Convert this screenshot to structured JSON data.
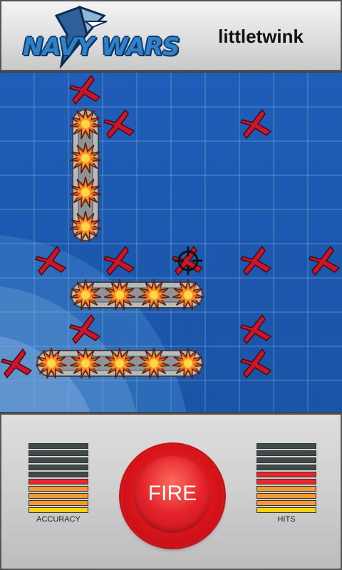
{
  "header": {
    "logo_text": "NAVY WARS",
    "player_name": "littletwink"
  },
  "board": {
    "rows": 10,
    "cols": 10,
    "misses": [
      [
        2,
        0
      ],
      [
        3,
        1
      ],
      [
        7,
        1
      ],
      [
        1,
        5
      ],
      [
        3,
        5
      ],
      [
        5,
        5
      ],
      [
        7,
        5
      ],
      [
        9,
        5
      ],
      [
        2,
        7
      ],
      [
        7,
        7
      ],
      [
        0,
        8
      ],
      [
        7,
        8
      ]
    ],
    "hits": [
      [
        2,
        1
      ],
      [
        2,
        2
      ],
      [
        2,
        3
      ],
      [
        2,
        4
      ],
      [
        2,
        6
      ],
      [
        3,
        6
      ],
      [
        4,
        6
      ],
      [
        5,
        6
      ],
      [
        1,
        8
      ],
      [
        2,
        8
      ],
      [
        3,
        8
      ],
      [
        4,
        8
      ],
      [
        5,
        8
      ]
    ],
    "ships": [
      {
        "col": 2,
        "row": 1,
        "length": 4,
        "orientation": "vertical"
      },
      {
        "col": 2,
        "row": 6,
        "length": 4,
        "orientation": "horizontal"
      },
      {
        "col": 1,
        "row": 8,
        "length": 5,
        "orientation": "horizontal"
      }
    ],
    "crosshair": [
      5,
      5
    ]
  },
  "controls": {
    "fire_label": "FIRE",
    "accuracy": {
      "label": "ACCURACY",
      "bars": [
        "#3f4a4a",
        "#3f4a4a",
        "#3f4a4a",
        "#3f4a4a",
        "#3f4a4a",
        "#e8262a",
        "#f29a30",
        "#f29a30",
        "#f29a30",
        "#f5d20e"
      ]
    },
    "hits": {
      "label": "HITS",
      "bars": [
        "#3f4a4a",
        "#3f4a4a",
        "#3f4a4a",
        "#3f4a4a",
        "#e8262a",
        "#e8262a",
        "#f29a30",
        "#f29a30",
        "#f29a30",
        "#f5d20e"
      ]
    }
  }
}
